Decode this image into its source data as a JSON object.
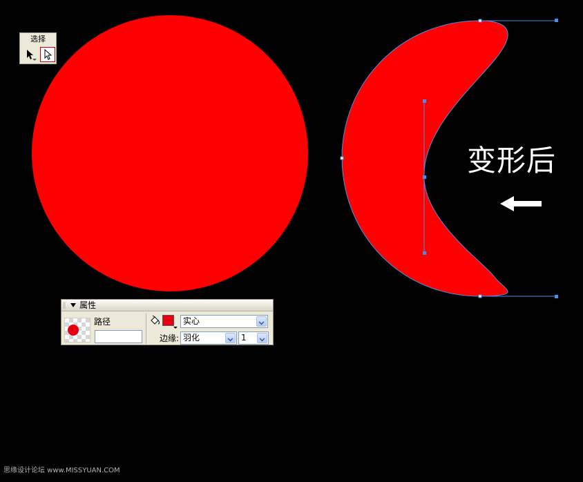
{
  "tool_panel": {
    "title": "选择",
    "tools": [
      {
        "name": "selection-tool",
        "icon": "arrow-icon"
      },
      {
        "name": "subselection-tool",
        "icon": "hollow-arrow-icon",
        "selected": true
      }
    ]
  },
  "canvas": {
    "background": "#000000",
    "circle_fill": "#ff0000",
    "shape_fill": "#ff0000",
    "path_stroke": "#4b8ee8"
  },
  "annotation": {
    "text": "变形后",
    "arrow_icon": "left-arrow-icon",
    "color": "#ffffff"
  },
  "properties_panel": {
    "title": "属性",
    "object_type": "路径",
    "object_name_value": "",
    "fill_color": "#e60012",
    "fill_type": "实心",
    "edge_label": "边缘:",
    "edge_type": "羽化",
    "edge_value": "1"
  },
  "watermark": "思缘设计论坛 www.MISSYUAN.COM"
}
